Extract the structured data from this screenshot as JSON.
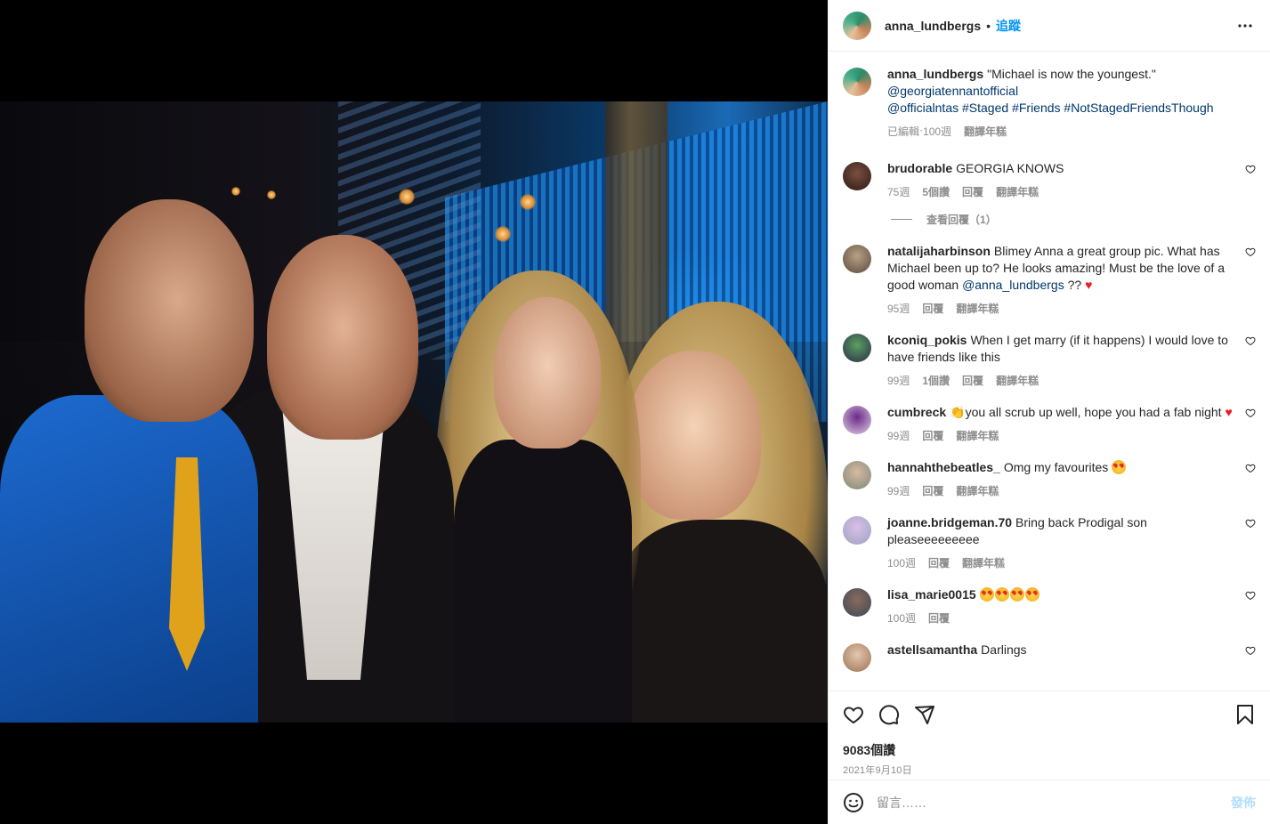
{
  "post": {
    "author": "anna_lundbergs",
    "dot": "•",
    "follow_label": "追蹤",
    "more_icon": "more-horizontal-icon",
    "photo_alt": "Group photo of four people at an event"
  },
  "caption": {
    "username": "anna_lundbergs",
    "text": "\"Michael is now the youngest.\"",
    "mention1": "@georgiatennantofficial",
    "mention2": "@officialntas",
    "tag1": "#Staged",
    "tag2": "#Friends",
    "tag3": "#NotStagedFriendsThough",
    "edited": "已編輯",
    "time": "100週",
    "translate": "翻譯年糕"
  },
  "comments": [
    {
      "username": "brudorable",
      "text": "GEORGIA KNOWS",
      "time": "75週",
      "likes": "5個讚",
      "reply": "回覆",
      "translate": "翻譯年糕",
      "replies": "查看回覆（1）"
    },
    {
      "username": "natalijaharbinson",
      "text": "Blimey Anna a great group pic. What has Michael been up to? He looks amazing! Must be the love of a good woman",
      "mention": "@anna_lundbergs",
      "suffix": "??",
      "time": "95週",
      "reply": "回覆",
      "translate": "翻譯年糕"
    },
    {
      "username": "kconiq_pokis",
      "text": "When I get marry (if it happens) I would love to have friends like this",
      "time": "99週",
      "likes": "1個讚",
      "reply": "回覆",
      "translate": "翻譯年糕"
    },
    {
      "username": "cumbreck",
      "text": "you all scrub up well, hope you had a fab night",
      "time": "99週",
      "reply": "回覆",
      "translate": "翻譯年糕"
    },
    {
      "username": "hannahthebeatles_",
      "text": "Omg my favourites",
      "time": "99週",
      "reply": "回覆",
      "translate": "翻譯年糕"
    },
    {
      "username": "joanne.bridgeman.70",
      "text": "Bring back Prodigal son pleaseeeeeeeee",
      "time": "100週",
      "reply": "回覆",
      "translate": "翻譯年糕"
    },
    {
      "username": "lisa_marie0015",
      "text": "",
      "time": "100週",
      "reply": "回覆"
    },
    {
      "username": "astellsamantha",
      "text": "Darlings"
    }
  ],
  "footer": {
    "likes": "9083個讚",
    "date": "2021年9月10日",
    "comment_placeholder": "留言……",
    "post_label": "發佈"
  },
  "colors": {
    "accent": "#0095f6",
    "link": "#00376b",
    "heart": "#ed1c24",
    "muted": "#8e8e8e"
  }
}
